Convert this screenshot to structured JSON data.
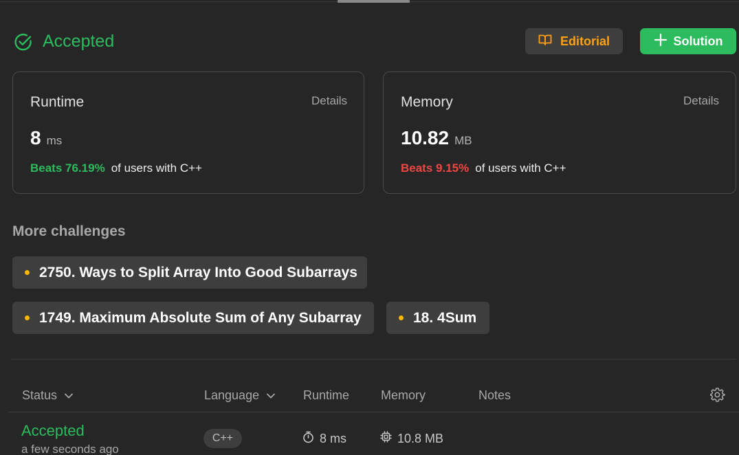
{
  "result": {
    "status": "Accepted",
    "editorial_label": "Editorial",
    "solution_label": "Solution"
  },
  "runtime_card": {
    "title": "Runtime",
    "details": "Details",
    "value": "8",
    "unit": "ms",
    "beats": "Beats 76.19%",
    "suffix": "of users with C++"
  },
  "memory_card": {
    "title": "Memory",
    "details": "Details",
    "value": "10.82",
    "unit": "MB",
    "beats": "Beats 9.15%",
    "suffix": "of users with C++"
  },
  "more_challenges": {
    "title": "More challenges",
    "items": [
      "2750. Ways to Split Array Into Good Subarrays",
      "1749. Maximum Absolute Sum of Any Subarray",
      "18. 4Sum"
    ]
  },
  "submissions": {
    "headers": {
      "status": "Status",
      "language": "Language",
      "runtime": "Runtime",
      "memory": "Memory",
      "notes": "Notes"
    },
    "rows": [
      {
        "status": "Accepted",
        "time": "a few seconds ago",
        "language": "C++",
        "runtime": "8 ms",
        "memory": "10.8 MB"
      }
    ]
  },
  "colors": {
    "accepted": "#2cbb5d",
    "editorial": "#ffa116",
    "beats_bad": "#ef4743",
    "chip_dot": "#ffb800"
  },
  "icons": [
    "check-circle-icon",
    "book-icon",
    "plus-icon",
    "chevron-down-icon",
    "gear-icon",
    "timer-icon",
    "chip-icon"
  ]
}
